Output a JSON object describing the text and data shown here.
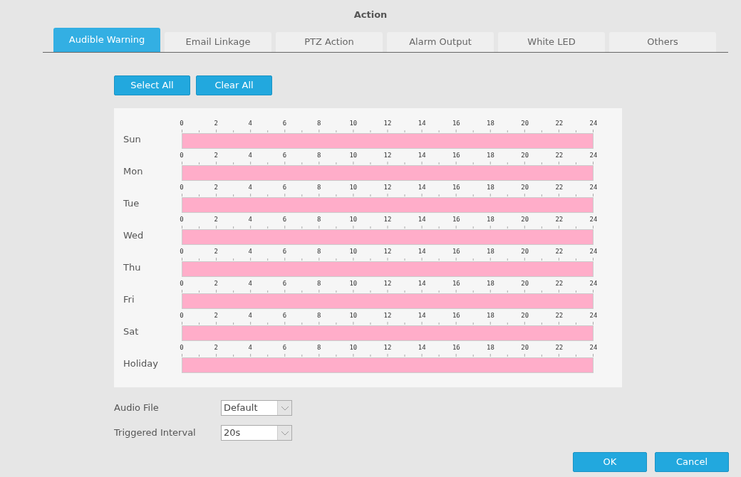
{
  "title": "Action",
  "tabs": [
    {
      "label": "Audible Warning",
      "selected": true
    },
    {
      "label": "Email Linkage",
      "selected": false
    },
    {
      "label": "PTZ Action",
      "selected": false
    },
    {
      "label": "Alarm Output",
      "selected": false
    },
    {
      "label": "White LED",
      "selected": false
    },
    {
      "label": "Others",
      "selected": false
    }
  ],
  "schedule_buttons": [
    "Select All",
    "Clear All"
  ],
  "schedule": [
    {
      "day": "Sun",
      "ticks": [
        "0",
        "2",
        "4",
        "6",
        "8",
        "10",
        "12",
        "14",
        "16",
        "18",
        "20",
        "22",
        "24"
      ],
      "level": 1
    },
    {
      "day": "Mon",
      "ticks": [
        "0",
        "2",
        "4",
        "6",
        "8",
        "10",
        "12",
        "14",
        "16",
        "18",
        "20",
        "22",
        "24"
      ],
      "level": 1
    },
    {
      "day": "Tue",
      "ticks": [
        "0",
        "2",
        "4",
        "6",
        "8",
        "10",
        "12",
        "14",
        "16",
        "18",
        "20",
        "22",
        "24"
      ],
      "level": 1
    },
    {
      "day": "Wed",
      "ticks": [
        "0",
        "2",
        "4",
        "6",
        "8",
        "10",
        "12",
        "14",
        "16",
        "18",
        "20",
        "22",
        "24"
      ],
      "level": 1
    },
    {
      "day": "Thu",
      "ticks": [
        "0",
        "2",
        "4",
        "6",
        "8",
        "10",
        "12",
        "14",
        "16",
        "18",
        "20",
        "22",
        "24"
      ],
      "level": 1
    },
    {
      "day": "Fri",
      "ticks": [
        "0",
        "2",
        "4",
        "6",
        "8",
        "10",
        "12",
        "14",
        "16",
        "18",
        "20",
        "22",
        "24"
      ],
      "level": 1
    },
    {
      "day": "Sat",
      "ticks": [
        "0",
        "2",
        "4",
        "6",
        "8",
        "10",
        "12",
        "14",
        "16",
        "18",
        "20",
        "22",
        "24"
      ],
      "level": 1
    },
    {
      "day": "Holiday",
      "ticks": [
        "0",
        "2",
        "4",
        "6",
        "8",
        "10",
        "12",
        "14",
        "16",
        "18",
        "20",
        "22",
        "24"
      ],
      "level": 1
    }
  ],
  "fields": [
    {
      "label": "Audio File",
      "value": "Default"
    },
    {
      "label": "Triggered Interval",
      "value": "20s"
    }
  ],
  "footer_buttons": [
    "OK",
    "Cancel"
  ]
}
